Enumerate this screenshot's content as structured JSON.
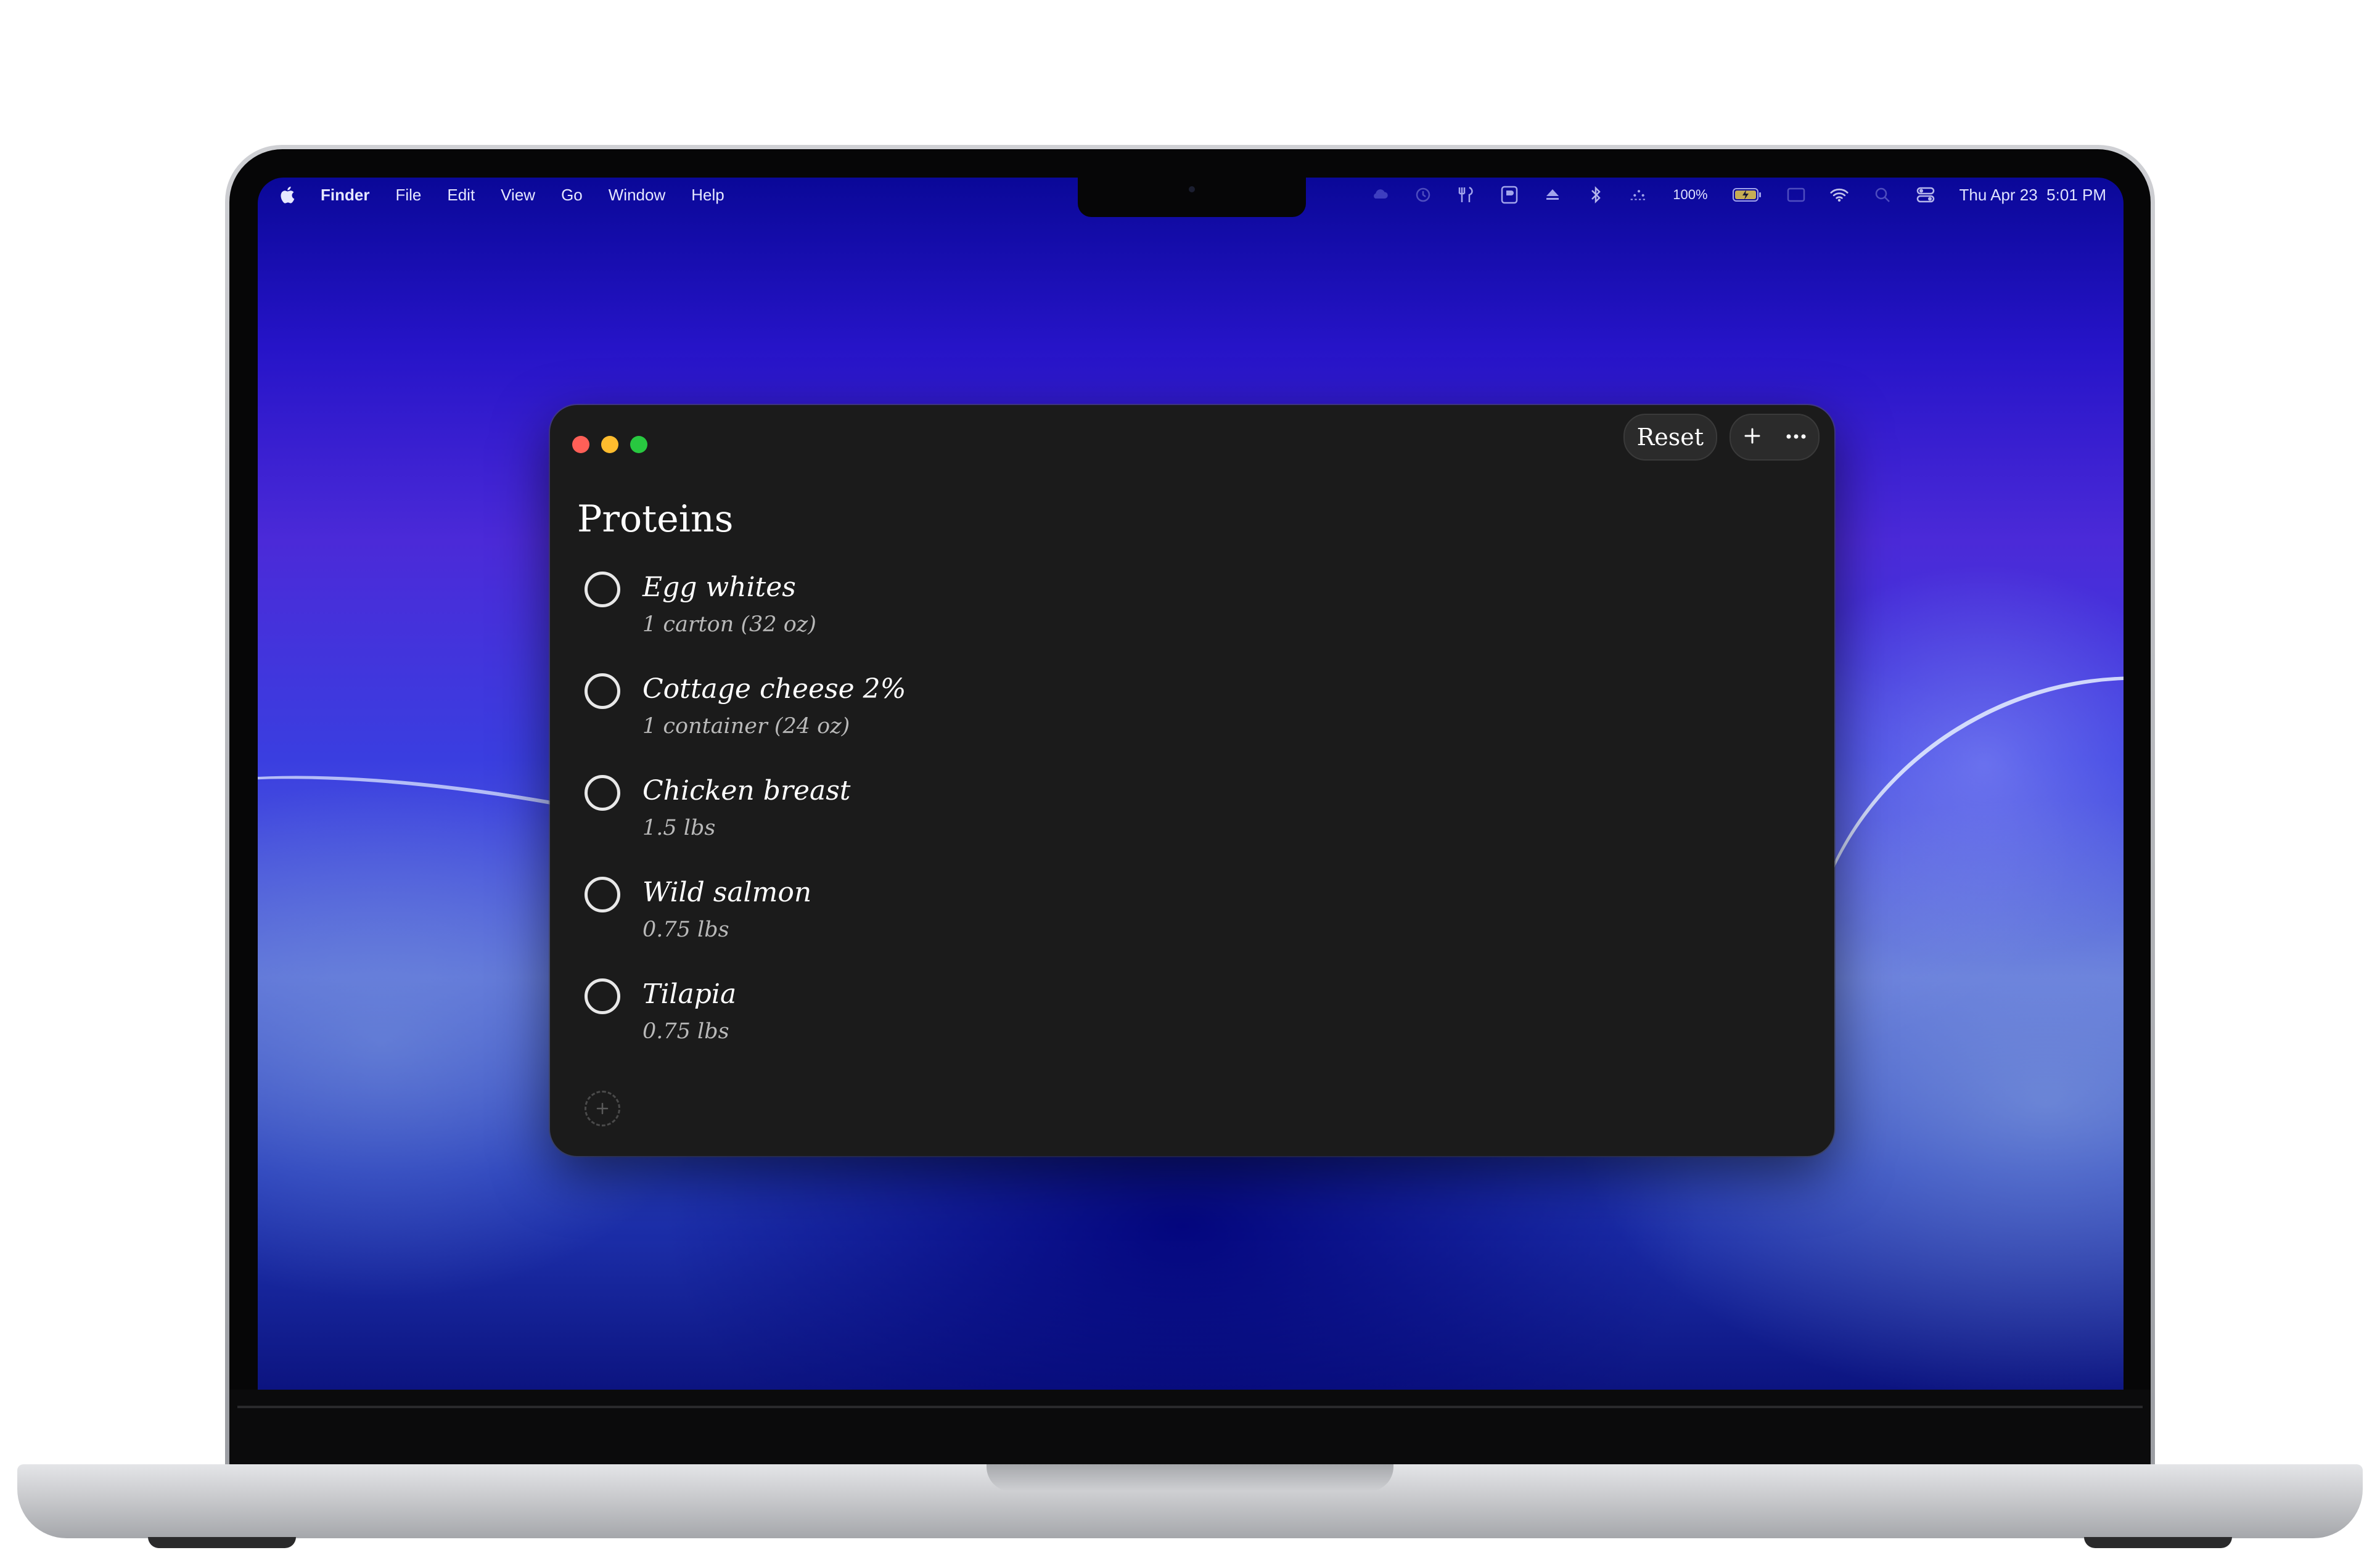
{
  "menubar": {
    "app_name": "Finder",
    "menus": [
      "File",
      "Edit",
      "View",
      "Go",
      "Window",
      "Help"
    ],
    "status_icons": [
      "cloud-icon",
      "clock-icon",
      "fork-knife-icon",
      "bookmark-icon",
      "eject-icon",
      "bluetooth-icon",
      "dots-icon",
      "battery-icon",
      "display-icon",
      "wifi-icon",
      "search-icon",
      "control-center-icon"
    ],
    "battery_percent": "100%",
    "clock": "Thu Apr 23  5:01 PM"
  },
  "window": {
    "toolbar": {
      "reset_label": "Reset",
      "add_icon": "plus-icon",
      "more_icon": "ellipsis-icon"
    },
    "list_title": "Proteins",
    "items": [
      {
        "name": "Egg whites",
        "quantity": "1 carton (32 oz)",
        "checked": false
      },
      {
        "name": "Cottage cheese 2%",
        "quantity": "1 container (24 oz)",
        "checked": false
      },
      {
        "name": "Chicken breast",
        "quantity": "1.5 lbs",
        "checked": false
      },
      {
        "name": "Wild salmon",
        "quantity": "0.75 lbs",
        "checked": false
      },
      {
        "name": "Tilapia",
        "quantity": "0.75 lbs",
        "checked": false
      }
    ]
  },
  "colors": {
    "window_bg": "#1b1b1b",
    "close": "#ff5f57",
    "minimize": "#febc2e",
    "zoom": "#28c840"
  }
}
